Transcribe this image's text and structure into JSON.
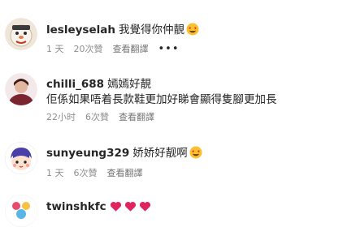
{
  "comments": [
    {
      "username": "lesleyselah",
      "text": "我覺得你仲靚",
      "emoji": "smiling-face-with-heart-eyes",
      "time": "1 天",
      "likes": "20次贊",
      "translate": "查看翻譯",
      "more": "•••"
    },
    {
      "username": "chilli_688",
      "text": "嫣嫣好靚",
      "text2": "佢係如果唔着長款鞋更加好睇會顯得隻腳更加長",
      "time": "22小时",
      "likes": "6次贊",
      "translate": "查看翻譯"
    },
    {
      "username": "sunyeung329",
      "text": "娇娇好靓啊",
      "emoji": "smiling-face-with-heart-eyes",
      "time": "1 天",
      "likes": "6次贊",
      "translate": "查看翻譯"
    },
    {
      "username": "twinshkfc",
      "text": "",
      "emoji": "red-heart x3"
    }
  ],
  "colors": {
    "text": "#262626",
    "meta": "#8e8e8e",
    "heart": "#e0245e"
  }
}
